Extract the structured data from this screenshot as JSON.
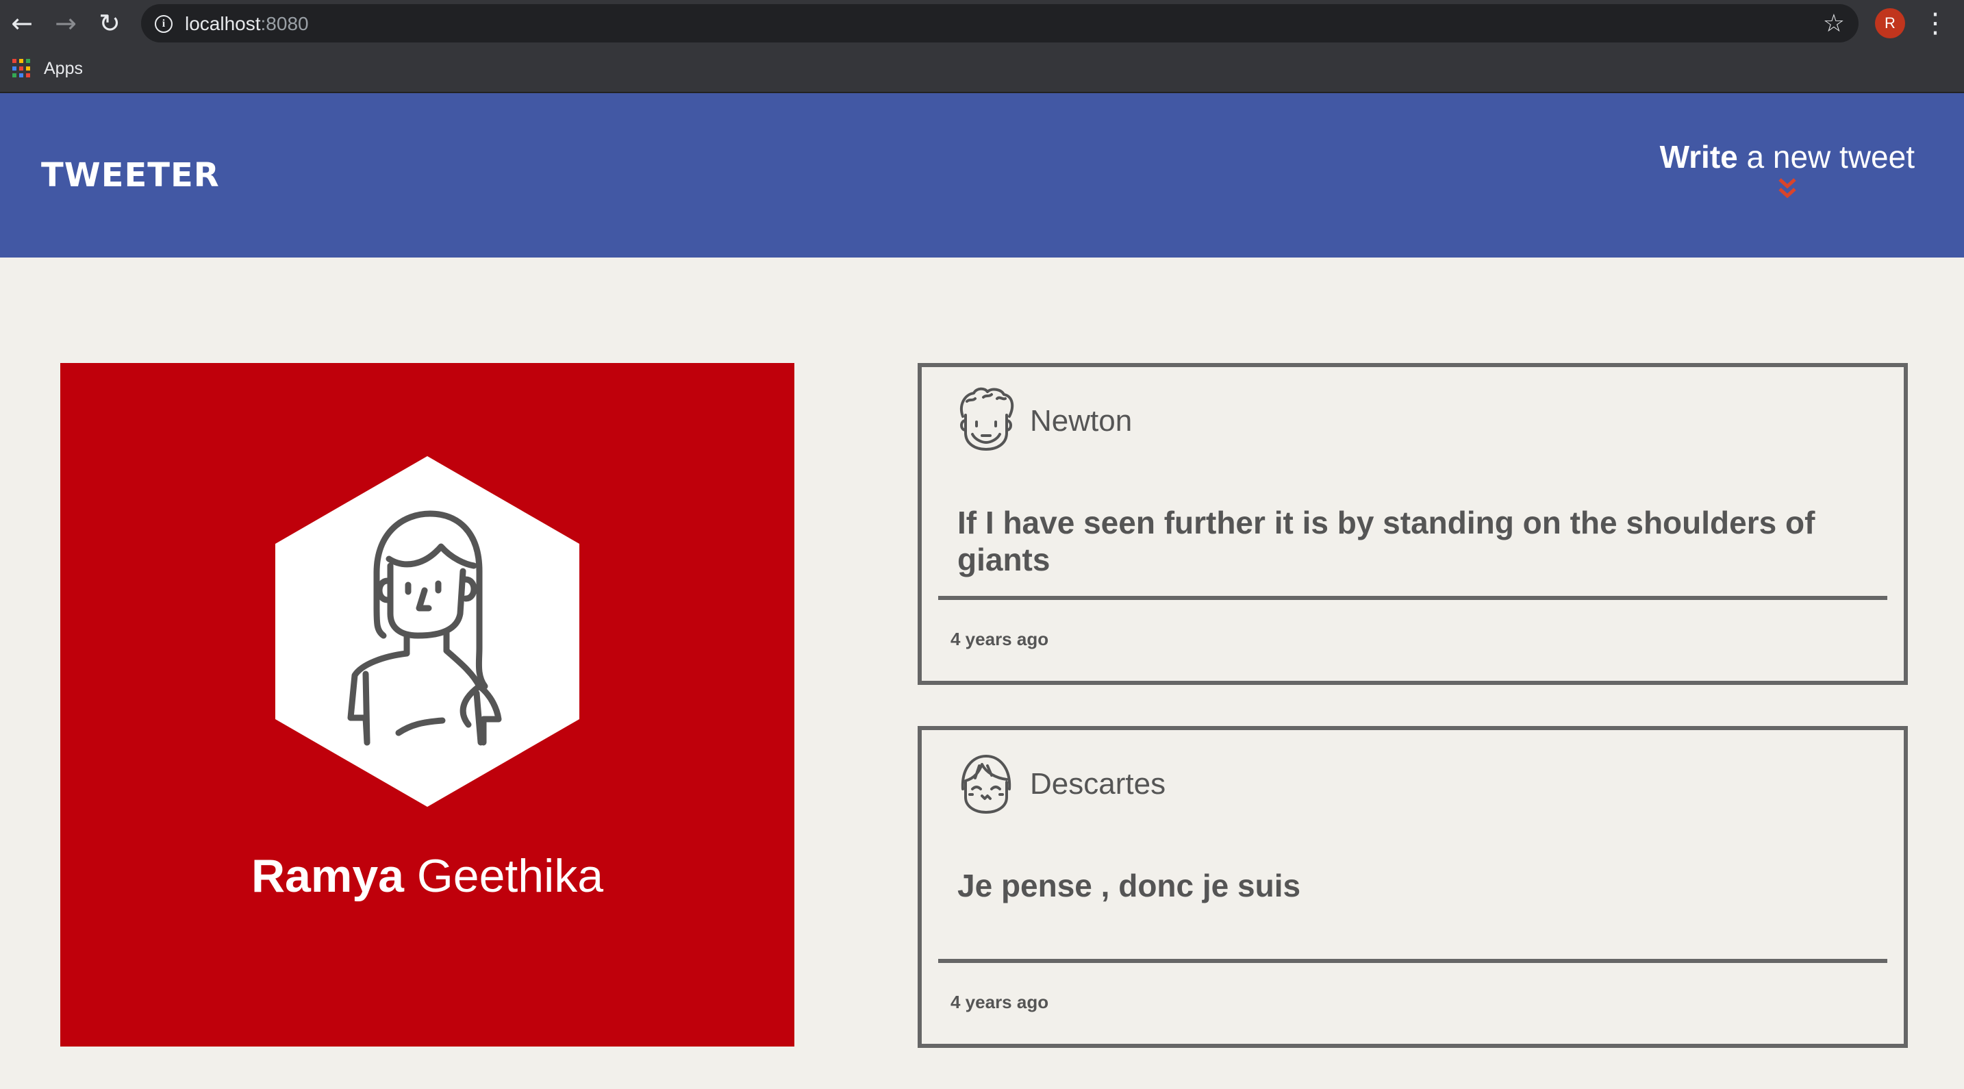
{
  "browser": {
    "url_host": "localhost",
    "url_port": ":8080",
    "profile_initial": "R",
    "bookmarks": {
      "apps_label": "Apps"
    }
  },
  "header": {
    "logo": "TWEETER",
    "compose_bold": "Write",
    "compose_rest": " a new tweet"
  },
  "profile": {
    "first_name": "Ramya",
    "last_name": "Geethika"
  },
  "tweets": [
    {
      "author": "Newton",
      "text": "If I have seen further it is by standing on the shoulders of giants",
      "time": "4 years ago",
      "avatar_icon": "curly-hair-avatar-icon"
    },
    {
      "author": "Descartes",
      "text": "Je pense , donc je suis",
      "time": "4 years ago",
      "avatar_icon": "bangs-avatar-icon"
    }
  ],
  "colors": {
    "header_bg": "#4258a4",
    "profile_bg": "#bf000b",
    "page_bg": "#f2f0eb",
    "accent_chevron": "#d9442b"
  }
}
